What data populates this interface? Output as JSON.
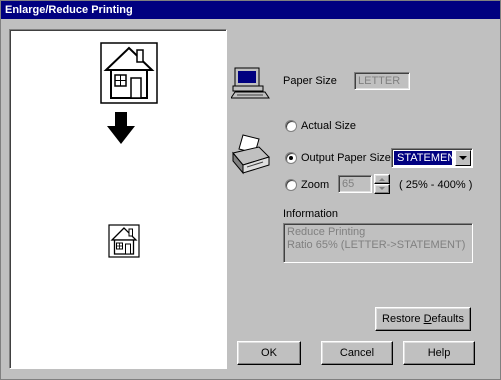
{
  "window": {
    "title": "Enlarge/Reduce Printing"
  },
  "paper_size": {
    "label": "Paper Size",
    "value": "LETTER"
  },
  "options": {
    "actual_size_label": "Actual Size",
    "output_paper_size_label": "Output Paper Size",
    "output_paper_size_value": "STATEMENT",
    "zoom_label": "Zoom",
    "zoom_value": "65",
    "zoom_range": "( 25% - 400% )",
    "selected": "output_paper_size"
  },
  "information": {
    "label": "Information",
    "line1": "Reduce Printing",
    "line2": "Ratio 65% (LETTER->STATEMENT)"
  },
  "buttons": {
    "restore_defaults_prefix": "Restore ",
    "restore_defaults_mnemonic": "D",
    "restore_defaults_suffix": "efaults",
    "ok": "OK",
    "cancel": "Cancel",
    "help": "Help"
  },
  "icons": {
    "computer": "computer-icon",
    "printer": "printer-icon",
    "house_large": "house-icon",
    "house_small": "house-icon",
    "arrow": "arrow-down-icon"
  },
  "colors": {
    "titlebar": "#000080",
    "dialog_bg": "#c0c0c0",
    "selection": "#000080"
  }
}
